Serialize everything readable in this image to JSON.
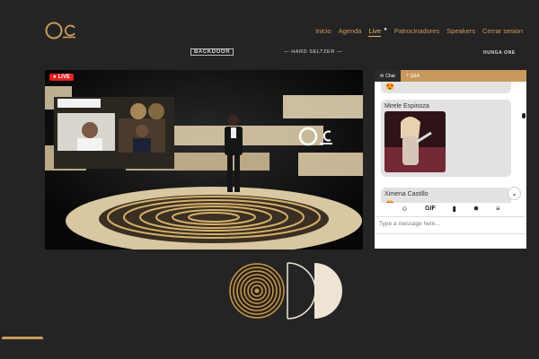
{
  "brand": {
    "logo_name": "Oc",
    "accent": "#c9995c"
  },
  "nav": {
    "items": [
      "Inicio",
      "Agenda",
      "Live",
      "Patrocinadores",
      "Speakers",
      "Cerrar sesion"
    ],
    "active": "Live"
  },
  "sponsors": [
    "BACKDOOR",
    "— HARD SELTZER —",
    "HUNGA ONE"
  ],
  "video": {
    "live_badge": "LIVE",
    "status_color": "#e52222"
  },
  "chat": {
    "tabs": [
      {
        "label": "Chat",
        "icon": "chat-icon"
      },
      {
        "label": "Q&A",
        "icon": "question-icon"
      }
    ],
    "messages": [
      {
        "name": "",
        "content": "emoji"
      },
      {
        "name": "Mirele Espinoza",
        "content": "image"
      },
      {
        "name": "Ximena Castillo",
        "content": "emoji"
      }
    ],
    "toolbar": [
      "emoji-icon",
      "GIF",
      "bookmark-icon",
      "gear-icon",
      "menu-icon"
    ],
    "input_placeholder": "Type a message here..."
  }
}
